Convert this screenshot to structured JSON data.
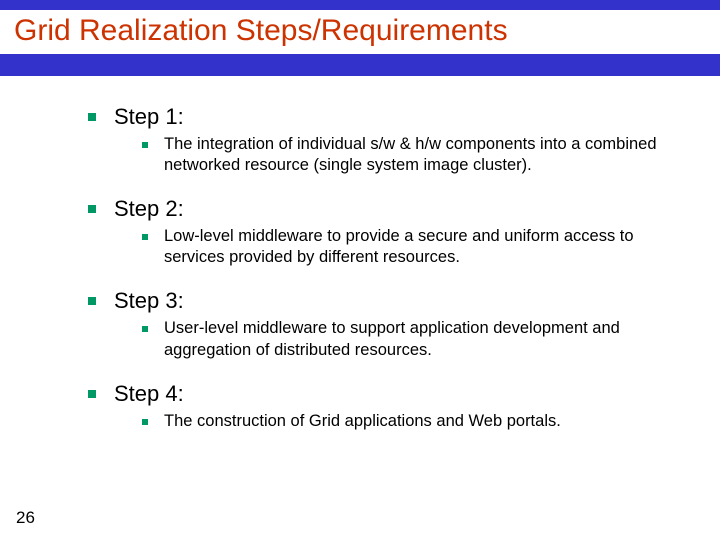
{
  "title": "Grid Realization Steps/Requirements",
  "steps": [
    {
      "label": "Step 1:",
      "detail": "The integration of individual s/w & h/w components into a combined networked resource (single system image cluster)."
    },
    {
      "label": "Step 2:",
      "detail": "Low-level middleware to provide a secure and uniform access to services provided by different resources."
    },
    {
      "label": "Step 3:",
      "detail": "User-level middleware to support application development and aggregation of distributed resources."
    },
    {
      "label": "Step 4:",
      "detail": "The construction of Grid applications and Web portals."
    }
  ],
  "page_number": "26"
}
